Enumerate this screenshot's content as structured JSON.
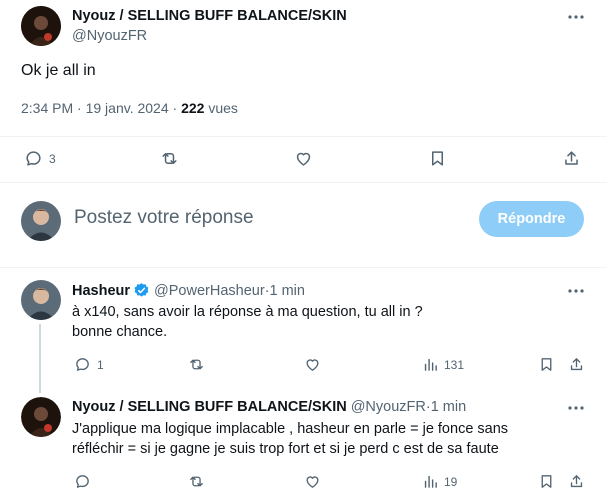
{
  "main_tweet": {
    "author_name": "Nyouz / SELLING BUFF BALANCE/SKIN",
    "author_handle": "@NyouzFR",
    "text": "Ok je all in",
    "time": "2:34 PM",
    "date": "19 janv. 2024",
    "views_count": "222",
    "views_label": "vues",
    "reply_count": "3"
  },
  "composer": {
    "placeholder": "Postez votre réponse",
    "reply_button": "Répondre"
  },
  "replies": [
    {
      "author_name": "Hasheur",
      "verified": true,
      "author_handle": "@PowerHasheur",
      "time": "1 min",
      "lines": [
        "à x140, sans avoir la réponse à ma question, tu all in ?",
        "bonne chance."
      ],
      "reply_count": "1",
      "views": "131"
    },
    {
      "author_name": "Nyouz / SELLING BUFF BALANCE/SKIN",
      "verified": false,
      "author_handle": "@NyouzFR",
      "time": "1 min",
      "lines": [
        "J'applique ma logique implacable , hasheur en parle = je fonce sans",
        "réfléchir = si je gagne je suis trop fort et si je perd c est de sa faute"
      ],
      "reply_count": "",
      "views": "19"
    }
  ],
  "colors": {
    "accent": "#1d9bf0",
    "button_disabled": "#8ecdf8",
    "text_secondary": "#536471",
    "divider": "#eff3f4"
  }
}
